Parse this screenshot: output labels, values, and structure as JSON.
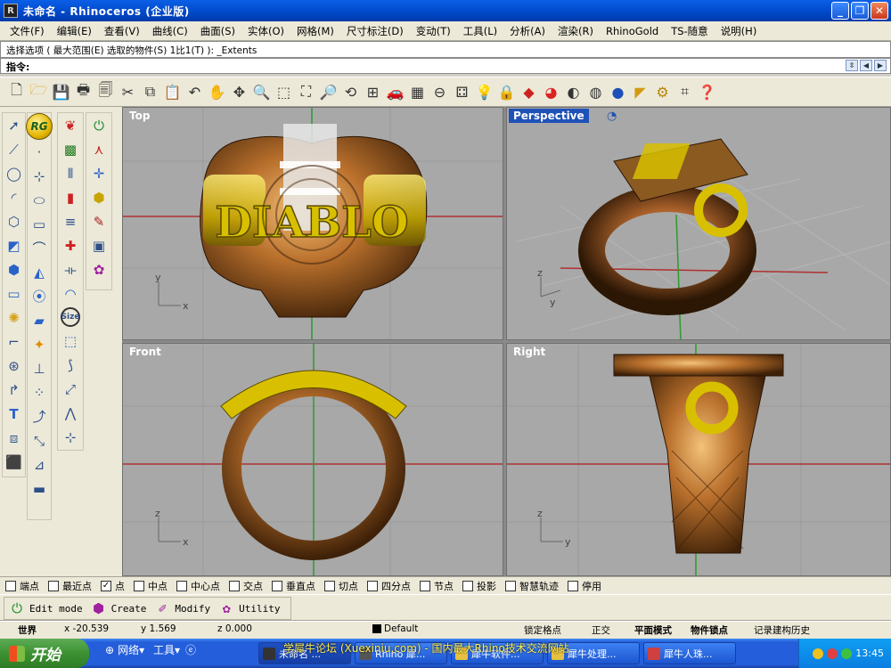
{
  "window": {
    "title": "未命名 - Rhinoceros (企业版)",
    "app_icon": "rhino-icon"
  },
  "menu": [
    "文件(F)",
    "编辑(E)",
    "查看(V)",
    "曲线(C)",
    "曲面(S)",
    "实体(O)",
    "网格(M)",
    "尺寸标注(D)",
    "变动(T)",
    "工具(L)",
    "分析(A)",
    "渲染(R)",
    "RhinoGold",
    "TS-随意",
    "说明(H)"
  ],
  "command": {
    "history": "选择选项 ( 最大范围(E)  选取的物件(S)  1比1(T) ): _Extents",
    "prompt": "指令:"
  },
  "viewports": {
    "top": {
      "label": "Top",
      "ring_text": "DIABLO"
    },
    "perspective": {
      "label": "Perspective"
    },
    "front": {
      "label": "Front"
    },
    "right": {
      "label": "Right"
    }
  },
  "axes": {
    "x": "x",
    "y": "y",
    "z": "z"
  },
  "osnaps": [
    {
      "label": "端点",
      "checked": false
    },
    {
      "label": "最近点",
      "checked": false
    },
    {
      "label": "点",
      "checked": true
    },
    {
      "label": "中点",
      "checked": false
    },
    {
      "label": "中心点",
      "checked": false
    },
    {
      "label": "交点",
      "checked": false
    },
    {
      "label": "垂直点",
      "checked": false
    },
    {
      "label": "切点",
      "checked": false
    },
    {
      "label": "四分点",
      "checked": false
    },
    {
      "label": "节点",
      "checked": false
    },
    {
      "label": "投影",
      "checked": false
    },
    {
      "label": "智慧轨迹",
      "checked": false
    },
    {
      "label": "停用",
      "checked": false
    }
  ],
  "rhinogold_tabs": [
    "Edit mode",
    "Create",
    "Modify",
    "Utility"
  ],
  "status": {
    "cplane": "世界",
    "x": "x -20.539",
    "y": "y 1.569",
    "z": "z 0.000",
    "layer": "Default",
    "grid_snap": "锁定格点",
    "ortho": "正交",
    "planar": "平面模式",
    "osnap": "物件锁点",
    "history": "记录建构历史"
  },
  "taskbar": {
    "start": "开始",
    "quick": [
      "网络",
      "工具"
    ],
    "tasks": [
      "未命名 ...",
      "Rhino 犀...",
      "犀牛软件...",
      "犀牛处理...",
      "犀牛人珠..."
    ],
    "clock": "13:45"
  },
  "watermark": "学犀牛论坛 (Xuexiniu.com) - 国内最大Rhino技术交流网站",
  "colors": {
    "titlebar": "#0048c8",
    "viewport_bg": "#a8a8a8",
    "active_label": "#1f52b8",
    "ring_gold": "#c77a34",
    "ring_yellow": "#d8c000"
  }
}
